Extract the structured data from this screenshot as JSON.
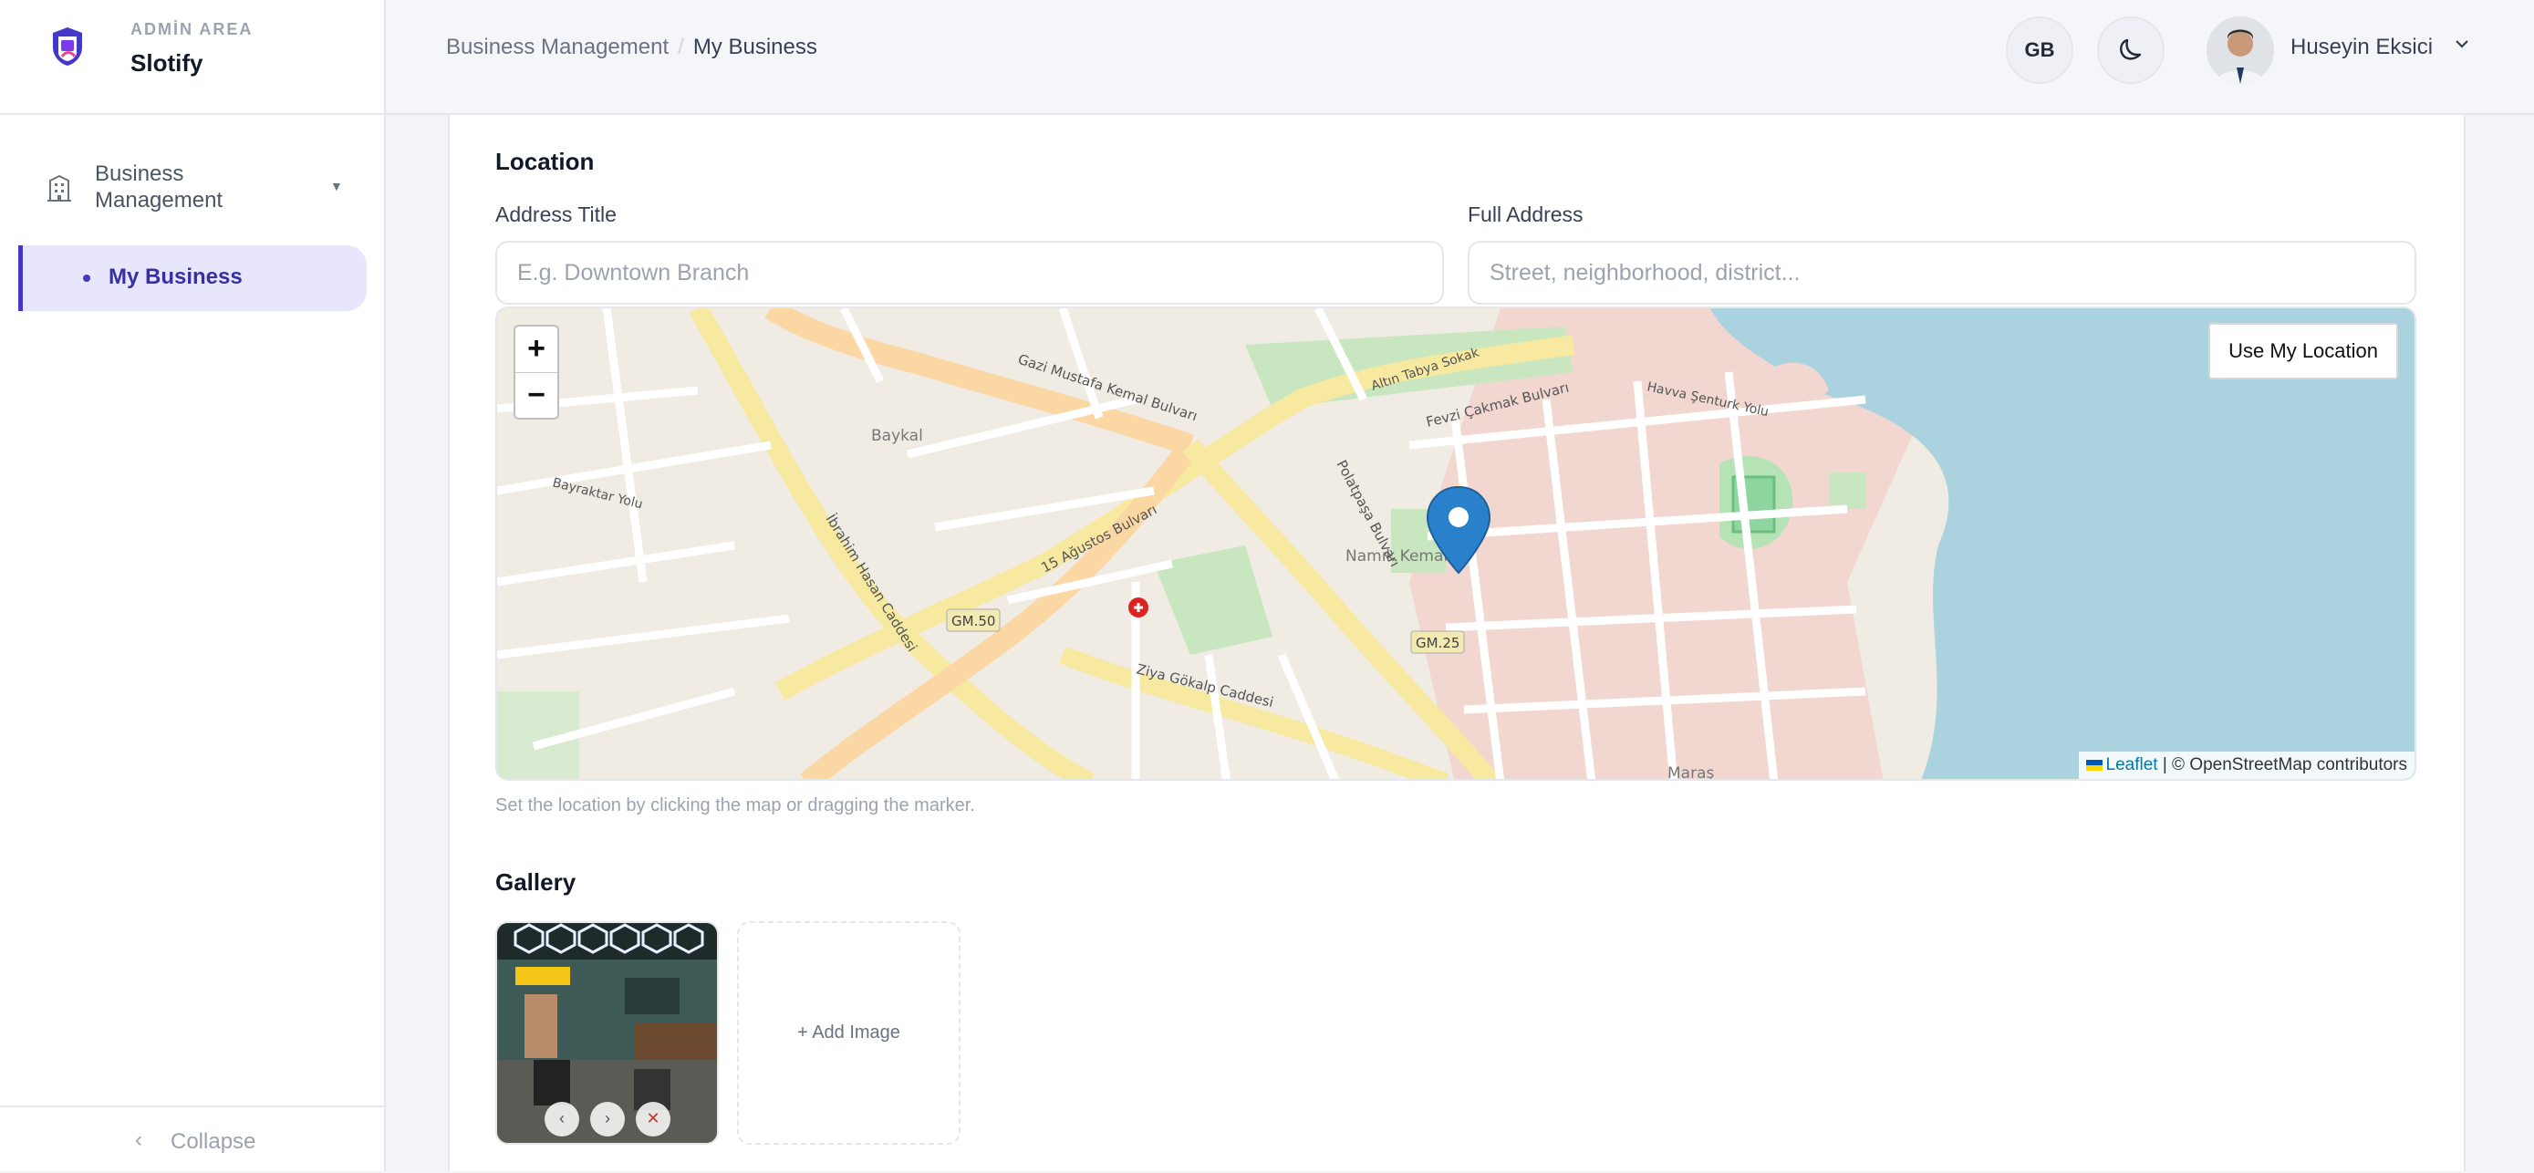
{
  "brand": {
    "area_label": "ADMİN AREA",
    "name": "Slotify"
  },
  "sidebar": {
    "group_label": "Business Management",
    "item_label": "My Business",
    "collapse_label": "Collapse"
  },
  "header": {
    "breadcrumb": [
      "Business Management",
      "My Business"
    ],
    "language": "GB",
    "user_name": "Huseyin Eksici"
  },
  "location": {
    "title": "Location",
    "address_title_label": "Address Title",
    "address_title_placeholder": "E.g. Downtown Branch",
    "full_address_label": "Full Address",
    "full_address_placeholder": "Street, neighborhood, district...",
    "use_location_label": "Use My Location",
    "zoom_in": "+",
    "zoom_out": "−",
    "attribution_leaflet": "Leaflet",
    "attribution_rest": " | © OpenStreetMap contributors",
    "hint": "Set the location by clicking the map or dragging the marker.",
    "map_labels": {
      "l1": "Gazi Mustafa Kemal Bulvarı",
      "l2": "Fevzi Çakmak Bulvarı",
      "l3": "15 Ağustos Bulvarı",
      "l4": "İbrahim Hasan Caddesi",
      "l5": "Ziya Gökalp Caddesi",
      "l6": "Namık Kemal",
      "l7": "Baykal",
      "l8": "GM.50",
      "l9": "GM.25",
      "l10": "Bayraktar Yolu",
      "l11": "Maraş",
      "l12": "Havva Şenturk Yolu",
      "l13": "Polatpaşa Bulvarı",
      "l14": "Altın Tabya Sokak"
    }
  },
  "gallery": {
    "title": "Gallery",
    "prev": "‹",
    "next": "›",
    "remove": "✕",
    "add_label": "+ Add Image"
  },
  "colors": {
    "accent": "#4338ca",
    "active_bg": "#e8e6fd",
    "sea": "#aad3df"
  }
}
